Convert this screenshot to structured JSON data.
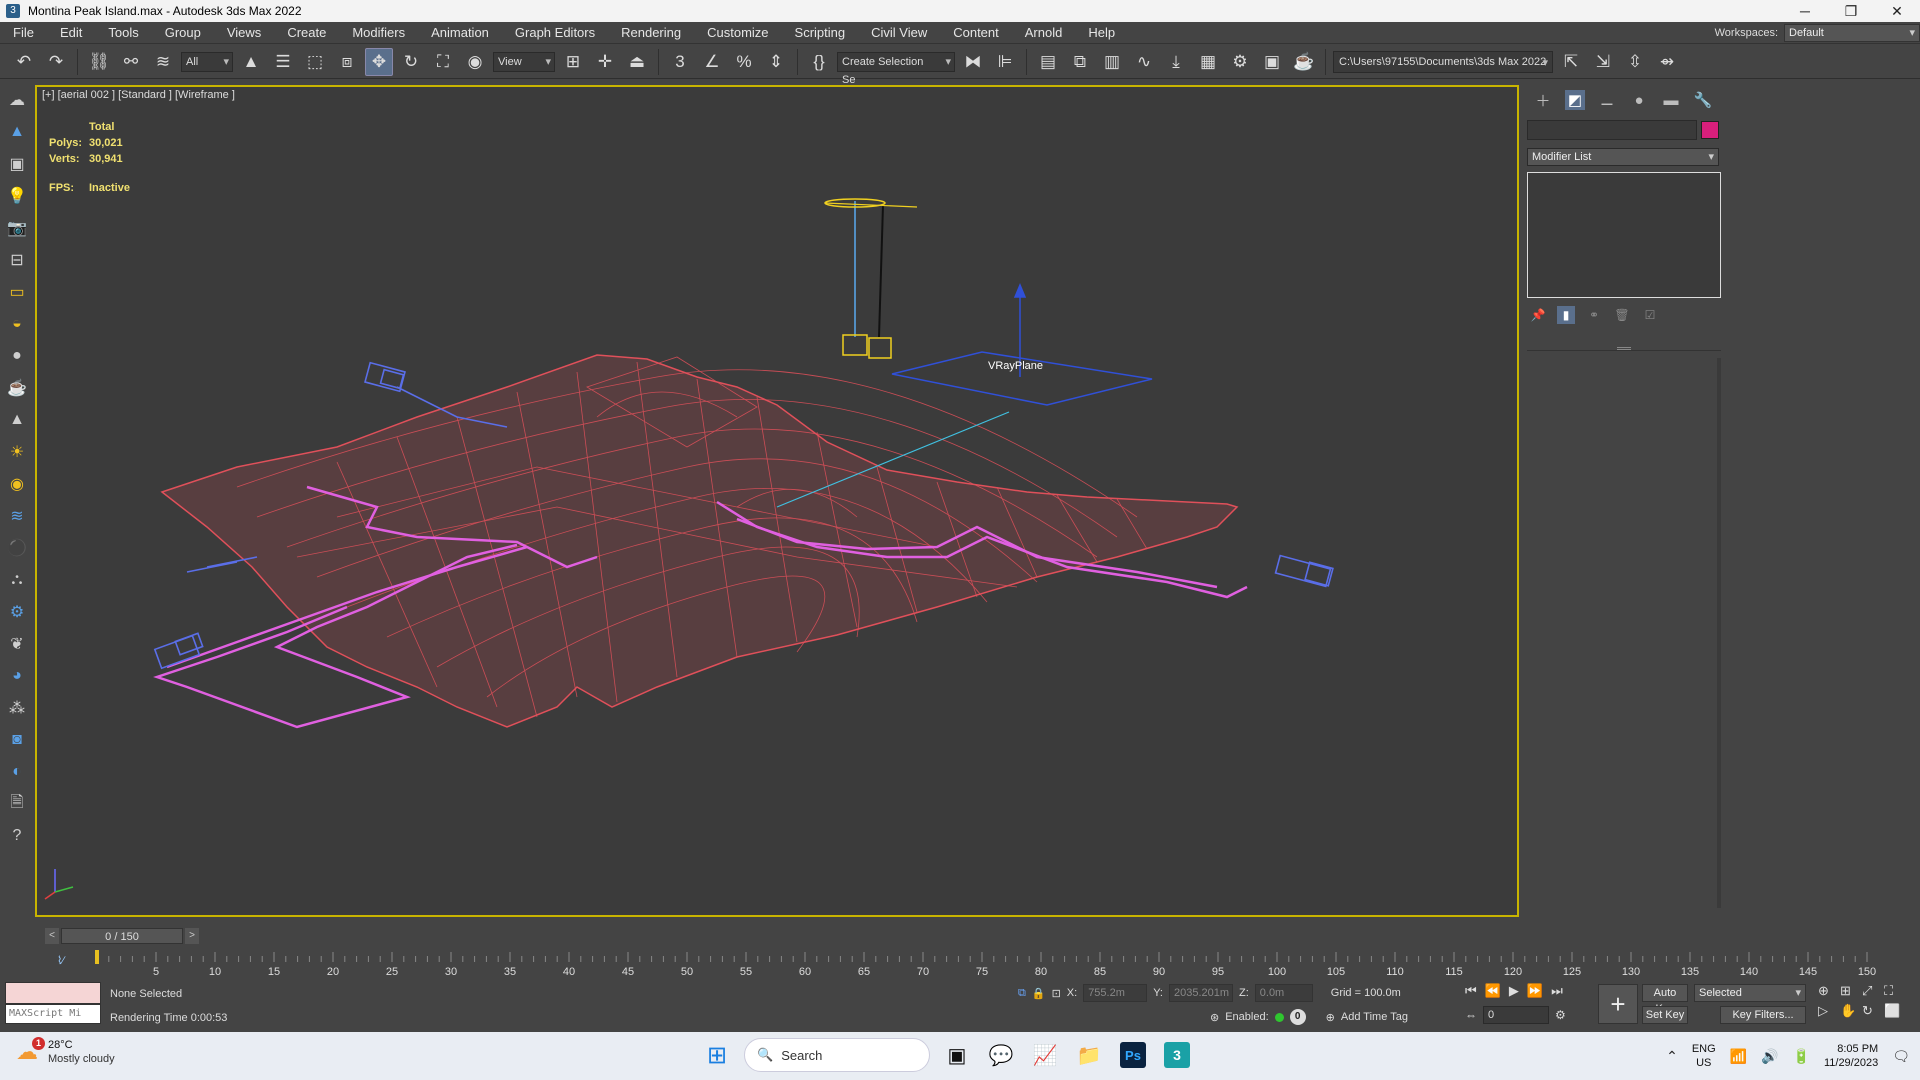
{
  "window": {
    "title": "Montina Peak Island.max - Autodesk 3ds Max 2022",
    "controls": [
      "─",
      "❐",
      "✕"
    ]
  },
  "menu": {
    "items": [
      "File",
      "Edit",
      "Tools",
      "Group",
      "Views",
      "Create",
      "Modifiers",
      "Animation",
      "Graph Editors",
      "Rendering",
      "Customize",
      "Scripting",
      "Civil View",
      "Content",
      "Arnold",
      "Help"
    ],
    "workspace_label": "Workspaces:",
    "workspace_value": "Default"
  },
  "toolbar": {
    "filter_value": "All",
    "view_value": "View",
    "selection_set_value": "Create Selection Se",
    "project_path": "C:\\Users\\97155\\Documents\\3ds Max 2022"
  },
  "viewport": {
    "label": "[+] [aerial 002 ] [Standard ] [Wireframe ]",
    "stats": {
      "total_label": "Total",
      "polys_label": "Polys:",
      "polys_value": "30,021",
      "verts_label": "Verts:",
      "verts_value": "30,941",
      "fps_label": "FPS:",
      "fps_value": "Inactive"
    },
    "object_label": "VRayPlane"
  },
  "command_panel": {
    "modifier_list": "Modifier List",
    "object_color": "#d81f7c"
  },
  "timeline": {
    "frame_display": "0 / 150",
    "ticks": [
      "5",
      "10",
      "15",
      "20",
      "25",
      "30",
      "35",
      "40",
      "45",
      "50",
      "55",
      "60",
      "65",
      "70",
      "75",
      "80",
      "85",
      "90",
      "95",
      "100",
      "105",
      "110",
      "115",
      "120",
      "125",
      "130",
      "135",
      "140",
      "145",
      "150"
    ],
    "prev": "<",
    "next": ">"
  },
  "status": {
    "maxscript_placeholder": "MAXScript Mi",
    "selection": "None Selected",
    "render_time": "Rendering Time  0:00:53",
    "x_label": "X:",
    "x_value": "755.2m",
    "y_label": "Y:",
    "y_value": "2035.201m",
    "z_label": "Z:",
    "z_value": "0.0m",
    "grid": "Grid = 100.0m",
    "enabled_label": "Enabled:",
    "enabled_count": "0",
    "add_time_tag": "Add Time Tag",
    "current_frame": "0",
    "auto_key": "Auto Key",
    "set_key": "Set Key",
    "key_mode": "Selected",
    "key_filters": "Key Filters..."
  },
  "taskbar": {
    "temperature": "28°C",
    "weather": "Mostly cloudy",
    "weather_badge": "1",
    "search_placeholder": "Search",
    "lang_top": "ENG",
    "lang_bottom": "US",
    "time": "8:05 PM",
    "date": "11/29/2023"
  },
  "colors": {
    "terrain": "#e0505a",
    "roads": "#e060e0",
    "vehicles": "#5a6ee8",
    "light": "#f0d020",
    "viewport_border": "#c8b400"
  }
}
